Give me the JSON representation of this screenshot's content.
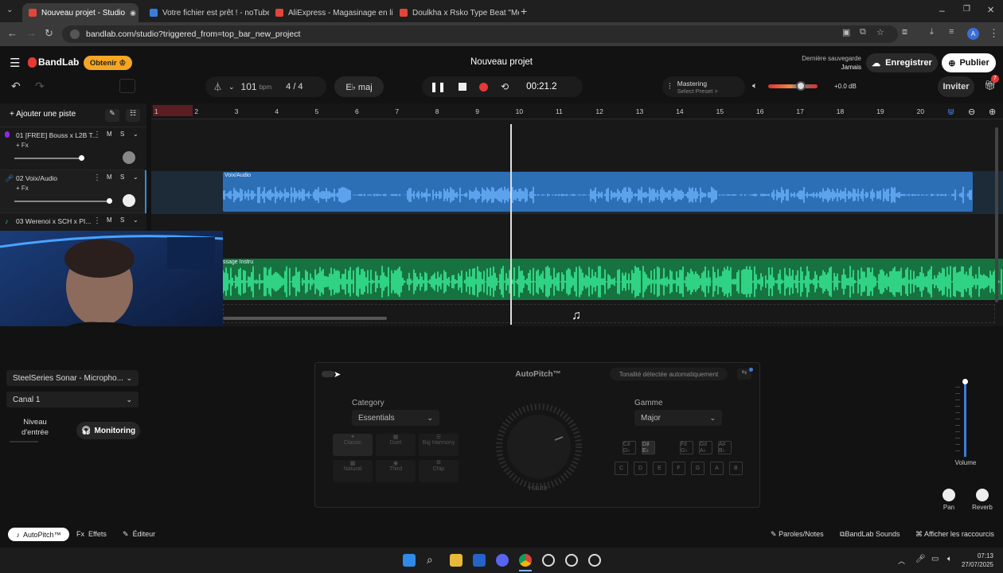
{
  "browser": {
    "tabs": [
      {
        "label": "Nouveau projet - Studio",
        "active": true,
        "color": "#e0463a"
      },
      {
        "label": "Votre fichier est prêt ! - noTube",
        "active": false,
        "color": "#3b7ddd"
      },
      {
        "label": "AliExpress - Magasinage en lign",
        "active": false,
        "color": "#e0463a"
      },
      {
        "label": "Doulkha x Rsko Type Beat \"Me",
        "active": false,
        "color": "#e0463a"
      }
    ],
    "url": "bandlab.com/studio?triggered_from=top_bar_new_project",
    "profile_initial": "A"
  },
  "app": {
    "brand": "BandLab",
    "get_button": "Obtenir",
    "project_title": "Nouveau projet",
    "last_save_label": "Dernière sauvegarde",
    "last_save_value": "Jamais",
    "save_button": "Enregistrer",
    "publish_button": "Publier",
    "invite_button": "Inviter",
    "notification_count": "7",
    "accent": "#e53935"
  },
  "transport": {
    "bpm": "101",
    "bpm_unit": "bpm",
    "time_sig": "4 / 4",
    "key": "E♭ maj",
    "time": "00:21.2",
    "mastering_label": "Mastering",
    "mastering_sub": "Select Preset >",
    "volume_db": "+0.0 dB"
  },
  "tracks_panel": {
    "add_track": "Ajouter une piste",
    "tracks": [
      {
        "number": "01",
        "name": "[FREE] Bouss x L2B T...",
        "fx": "+ Fx",
        "m": "M",
        "s": "S",
        "color": "#8a2be2"
      },
      {
        "number": "02",
        "name": "Voix/Audio",
        "fx": "+ Fx",
        "m": "M",
        "s": "S",
        "color": "#2f8fd8"
      },
      {
        "number": "03",
        "name": "Werenoi x SCH x PI...",
        "fx": "+ Fx",
        "m": "M",
        "s": "S",
        "color": "#1ecb74"
      }
    ]
  },
  "arrangement": {
    "bars": [
      "1",
      "2",
      "3",
      "4",
      "5",
      "6",
      "7",
      "8",
      "9",
      "10",
      "11",
      "12",
      "13",
      "14",
      "15",
      "16",
      "17",
      "18",
      "19",
      "20"
    ],
    "clip_vocal_label": "Voix/Audio",
    "clip_instru_label": "ssage Instru",
    "vocal_color": "#2d6fb5",
    "instru_color": "#1ec97a"
  },
  "input_panel": {
    "device": "SteelSeries Sonar - Micropho...",
    "channel": "Canal 1",
    "level_label": "Niveau d'entrée",
    "monitoring": "Monitoring"
  },
  "autopitch": {
    "title": "AutoPitch™",
    "auto_key": "Tonalité détectée automatiquement",
    "category_label": "Category",
    "category_value": "Essentials",
    "scale_label": "Gamme",
    "scale_value": "Major",
    "knob_label": "Haute",
    "presets": [
      "Classic",
      "Duet",
      "Big Harmony",
      "Natural",
      "Third",
      "Chip"
    ],
    "notes_top": [
      "C♯ D♭",
      "D♯ E♭",
      "F♯ G♭",
      "G♯ A♭",
      "A♯ B♭"
    ],
    "notes_bottom": [
      "C",
      "D",
      "E",
      "F",
      "G",
      "A",
      "B"
    ]
  },
  "mixer": {
    "volume_label": "Volume",
    "pan_label": "Pan",
    "reverb_label": "Reverb"
  },
  "footer": {
    "autopitch_tab": "AutoPitch™",
    "effects_tab": "Effets",
    "editor_tab": "Éditeur",
    "lyrics": "Paroles/Notes",
    "sounds": "BandLab Sounds",
    "shortcuts": "Afficher les raccourcis"
  },
  "taskbar": {
    "time": "07:13",
    "date": "27/07/2025"
  }
}
